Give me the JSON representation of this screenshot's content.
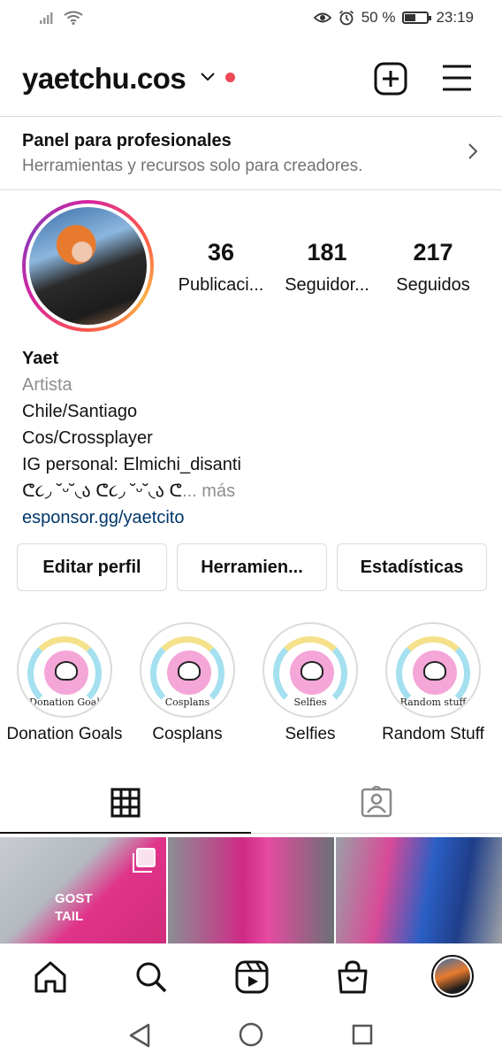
{
  "status_bar": {
    "battery": "50 %",
    "battery_level": 0.5,
    "time": "23:19"
  },
  "profile": {
    "username": "yaetchu.cos",
    "posts": {
      "count": "36",
      "label": "Publicaci..."
    },
    "followers": {
      "count": "181",
      "label": "Seguidor..."
    },
    "following": {
      "count": "217",
      "label": "Seguidos"
    }
  },
  "pro_panel": {
    "title": "Panel para profesionales",
    "subtitle": "Herramientas y recursos solo para creadores."
  },
  "bio": {
    "name": "Yaet",
    "category": "Artista",
    "lines": [
      "Chile/Santiago",
      "Cos/Crossplayer",
      "IG personal: Elmichi_disanti"
    ],
    "truncated_line": "ᕦ૮◞ ˘ᵕ˘◟ა ᕦ૮◞ ˘ᵕ˘◟ა ᕦ",
    "more": "... más",
    "link": "esponsor.gg/yaetcito"
  },
  "buttons": {
    "edit": "Editar perfil",
    "tools": "Herramien...",
    "stats": "Estadísticas"
  },
  "highlights": [
    {
      "label": "Donation Goals",
      "inner": "Donation Goal"
    },
    {
      "label": "Cosplans",
      "inner": "Cosplans"
    },
    {
      "label": "Selfies",
      "inner": "Selfies"
    },
    {
      "label": "Random Stuff",
      "inner": "Random stuff"
    }
  ],
  "posts_grid": [
    {
      "caption_text": "GOST TAIL",
      "multiple": true
    },
    {
      "caption_text": "",
      "multiple": false
    },
    {
      "caption_text": "",
      "multiple": false
    }
  ],
  "colors": {
    "notification_dot": "#ed4956",
    "link": "#00376b",
    "secondary_text": "#737373"
  },
  "icons": {
    "status": [
      "signal-icon",
      "wifi-icon",
      "eye-icon",
      "alarm-icon",
      "battery-icon"
    ],
    "top": [
      "chevron-down-icon",
      "new-post-icon",
      "menu-icon"
    ],
    "tabs": [
      "grid-icon",
      "tagged-icon"
    ],
    "bottom_nav": [
      "home-icon",
      "search-icon",
      "reels-icon",
      "shop-icon",
      "profile-avatar"
    ],
    "system_nav": [
      "back-icon",
      "home-circle-icon",
      "recents-icon"
    ]
  }
}
